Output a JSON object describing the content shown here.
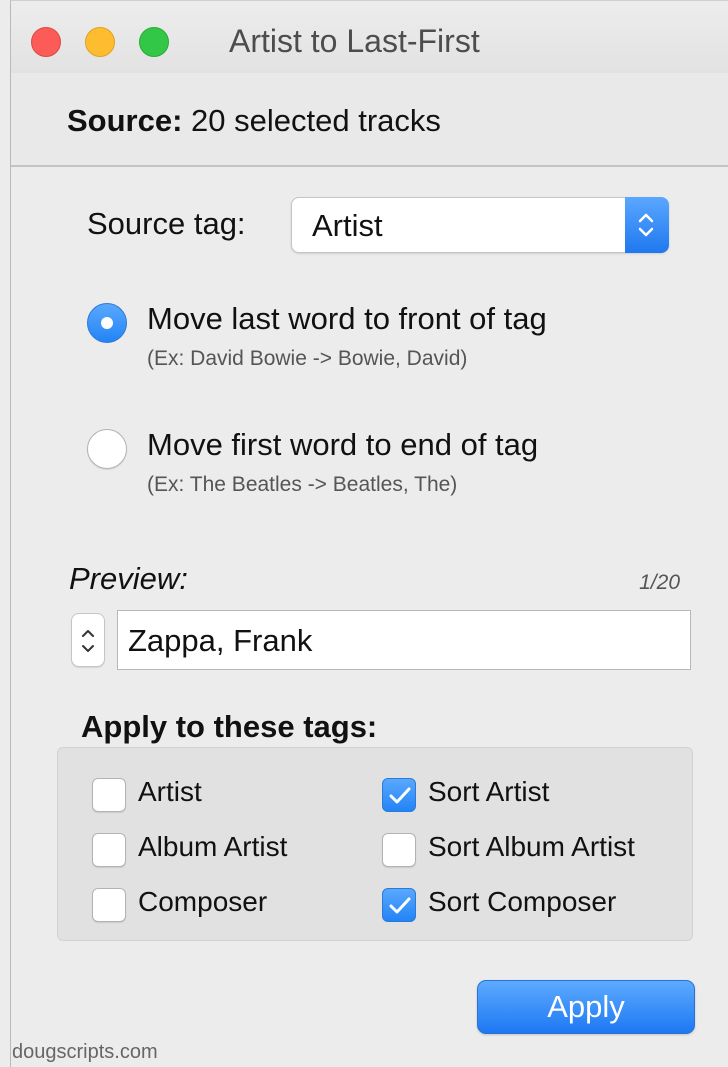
{
  "window": {
    "title": "Artist to Last-First"
  },
  "source": {
    "label": "Source:",
    "value": "20 selected tracks"
  },
  "source_tag": {
    "label": "Source tag:",
    "selected": "Artist"
  },
  "mode_options": [
    {
      "label": "Move last word to front of tag",
      "example": "(Ex: David Bowie -> Bowie, David)",
      "selected": true
    },
    {
      "label": "Move first word to end of tag",
      "example": "(Ex: The Beatles -> Beatles, The)",
      "selected": false
    }
  ],
  "preview": {
    "label": "Preview:",
    "count": "1/20",
    "value": "Zappa, Frank"
  },
  "apply_tags": {
    "label": "Apply to these tags:",
    "options": [
      {
        "label": "Artist",
        "checked": false
      },
      {
        "label": "Album Artist",
        "checked": false
      },
      {
        "label": "Composer",
        "checked": false
      },
      {
        "label": "Sort Artist",
        "checked": true
      },
      {
        "label": "Sort Album Artist",
        "checked": false
      },
      {
        "label": "Sort Composer",
        "checked": true
      }
    ]
  },
  "apply_button": "Apply",
  "footer": "dougscripts.com",
  "colors": {
    "accent": "#2384f5",
    "background": "#ececec"
  }
}
